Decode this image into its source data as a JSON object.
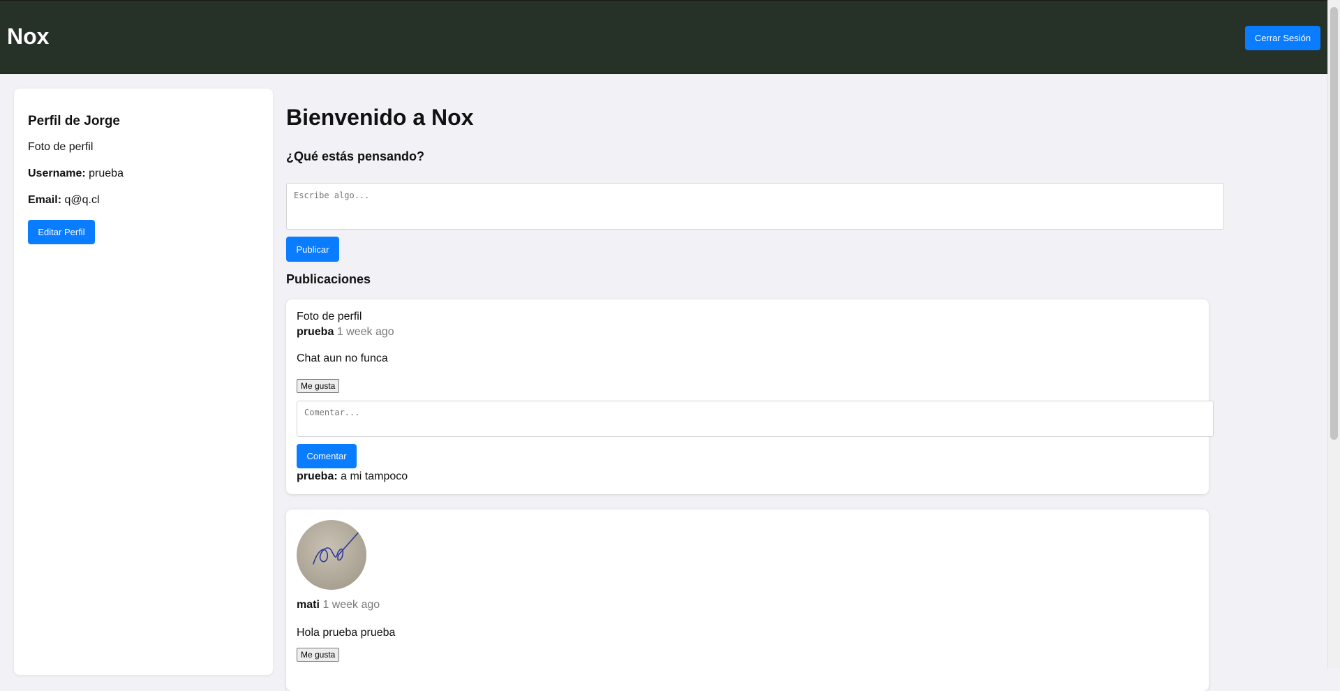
{
  "header": {
    "brand": "Nox",
    "logout_label": "Cerrar Sesión"
  },
  "profile": {
    "title": "Perfil de Jorge",
    "photo_alt": "Foto de perfil",
    "username_label": "Username:",
    "username_value": "prueba",
    "email_label": "Email:",
    "email_value": "q@q.cl",
    "edit_label": "Editar Perfil"
  },
  "main": {
    "welcome": "Bienvenido a Nox",
    "question": "¿Qué estás pensando?",
    "post_placeholder": "Escribe algo...",
    "publish_label": "Publicar",
    "posts_title": "Publicaciones"
  },
  "posts": [
    {
      "photo_alt": "Foto de perfil",
      "author": "prueba",
      "time": "1 week ago",
      "content": "Chat aun no funca",
      "like_label": "Me gusta",
      "comment_placeholder": "Comentar...",
      "comment_button": "Comentar",
      "comments": [
        {
          "author": "prueba:",
          "text": "a mi tampoco"
        }
      ]
    },
    {
      "author": "mati",
      "time": "1 week ago",
      "content": "Hola prueba prueba",
      "like_label": "Me gusta"
    }
  ],
  "colors": {
    "header_bg": "#263228",
    "accent": "#0a7cff",
    "page_bg": "#f2f2f6"
  }
}
